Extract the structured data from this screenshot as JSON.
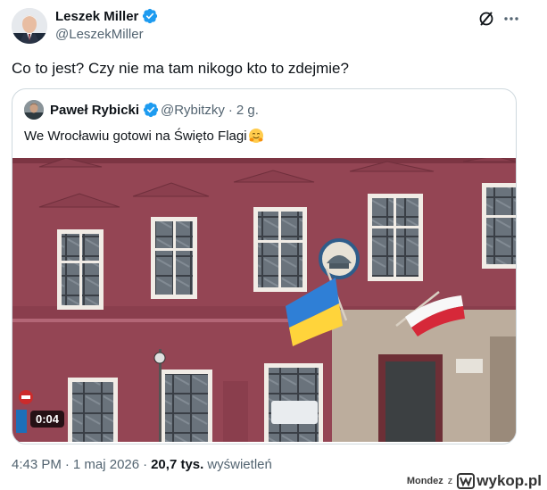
{
  "author": {
    "display_name": "Leszek Miller",
    "handle": "@LeszekMiller"
  },
  "tweet": {
    "text": "Co to jest? Czy nie ma tam nikogo kto to zdejmie?"
  },
  "quoted": {
    "display_name": "Paweł Rybicki",
    "handle": "@Rybitzky",
    "separator": "·",
    "age": "2 g.",
    "text": "We Wrocławiu gotowi na Święto Flagi",
    "emoji": "hugging-face-emoji"
  },
  "video": {
    "duration": "0:04"
  },
  "footer": {
    "time": "4:43 PM",
    "separator": "·",
    "date": "1 maj 2026",
    "separator2": "·",
    "views_count": "20,7 tys.",
    "views_label": "wyświetleń"
  },
  "watermark": {
    "user": "Mondez",
    "z": "z",
    "site": "wykop.pl"
  },
  "colors": {
    "verified": "#1d9bf0",
    "secondary_text": "#536471",
    "border": "#cfd9de",
    "building": "#9b4858"
  },
  "icons": {
    "verified": "verified-badge-icon",
    "grok": "grok-icon",
    "more": "more-icon"
  }
}
